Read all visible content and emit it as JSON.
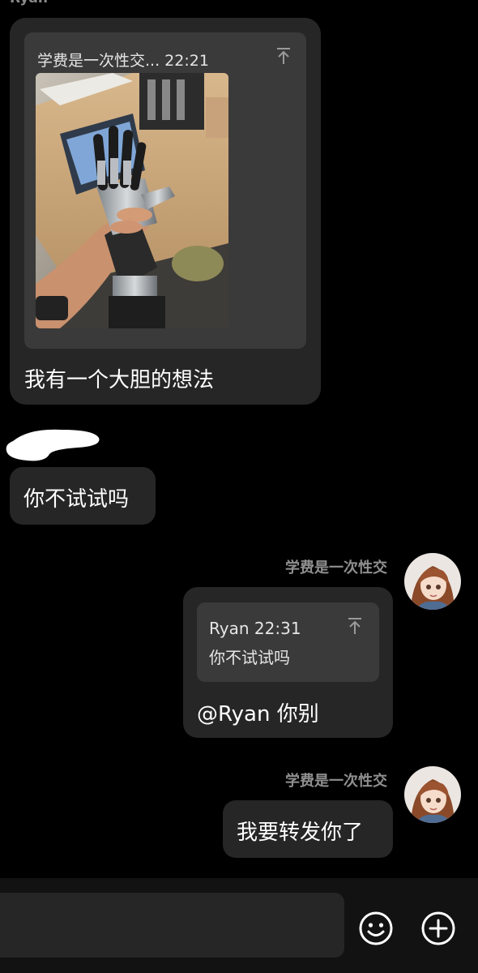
{
  "top_sender": {
    "name": "Ryan"
  },
  "messages": [
    {
      "direction": "in",
      "quote": {
        "header": "学费是一次性交... 22:21",
        "image": "photo of a robotic hand held by a person in an office"
      },
      "text": "我有一个大胆的想法"
    },
    {
      "direction": "in",
      "text": "你不试试吗"
    },
    {
      "direction": "out",
      "sender": "学费是一次性交",
      "quote": {
        "header": "Ryan 22:31",
        "body": "你不试试吗"
      },
      "text": "@Ryan 你别"
    },
    {
      "direction": "out",
      "sender": "学费是一次性交",
      "text": "我要转发你了"
    }
  ],
  "input_bar": {
    "placeholder": "",
    "emoji_icon": "smiley-face-icon",
    "plus_icon": "plus-circle-icon"
  },
  "colors": {
    "background": "#000000",
    "bubble": "#262626",
    "quote_card": "#3a3a3a",
    "sender_name": "#8f8f8f"
  }
}
